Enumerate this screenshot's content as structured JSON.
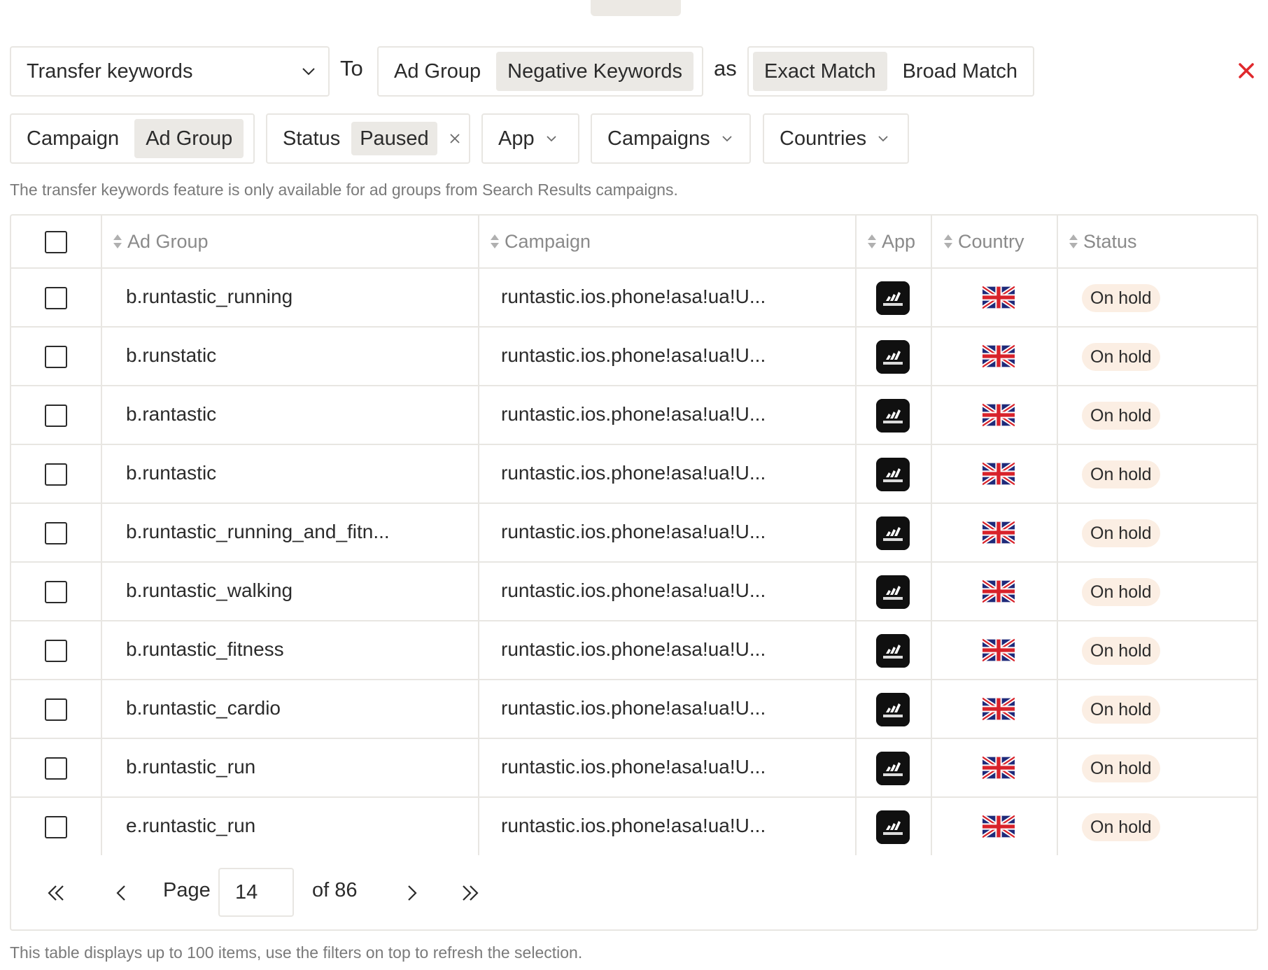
{
  "transfer": {
    "action_value": "Transfer keywords",
    "to_label": "To",
    "target_options": [
      "Ad Group",
      "Negative Keywords"
    ],
    "target_selected": "Negative Keywords",
    "as_label": "as",
    "match_options": [
      "Exact Match",
      "Broad Match"
    ],
    "match_selected": "Exact Match",
    "close_color": "#e0282c"
  },
  "filters": {
    "level_options": [
      "Campaign",
      "Ad Group"
    ],
    "level_selected": "Ad Group",
    "status_label": "Status",
    "status_value": "Paused",
    "app_label": "App",
    "campaigns_label": "Campaigns",
    "countries_label": "Countries"
  },
  "notes": {
    "availability": "The transfer keywords feature is only available for ad groups from Search Results campaigns.",
    "limit": "This table displays up to 100 items, use the filters on top to refresh the selection."
  },
  "table": {
    "headers": {
      "ad_group": "Ad Group",
      "campaign": "Campaign",
      "app": "App",
      "country": "Country",
      "status": "Status"
    },
    "rows": [
      {
        "ad_group": "b.runtastic_running",
        "campaign": "runtastic.ios.phone!asa!ua!U...",
        "app_icon": "adidas-running-app-icon",
        "country_flag": "uk-flag-icon",
        "status": "On hold"
      },
      {
        "ad_group": "b.runstatic",
        "campaign": "runtastic.ios.phone!asa!ua!U...",
        "app_icon": "adidas-running-app-icon",
        "country_flag": "uk-flag-icon",
        "status": "On hold"
      },
      {
        "ad_group": "b.rantastic",
        "campaign": "runtastic.ios.phone!asa!ua!U...",
        "app_icon": "adidas-running-app-icon",
        "country_flag": "uk-flag-icon",
        "status": "On hold"
      },
      {
        "ad_group": "b.runtastic",
        "campaign": "runtastic.ios.phone!asa!ua!U...",
        "app_icon": "adidas-running-app-icon",
        "country_flag": "uk-flag-icon",
        "status": "On hold"
      },
      {
        "ad_group": "b.runtastic_running_and_fitn...",
        "campaign": "runtastic.ios.phone!asa!ua!U...",
        "app_icon": "adidas-running-app-icon",
        "country_flag": "uk-flag-icon",
        "status": "On hold"
      },
      {
        "ad_group": "b.runtastic_walking",
        "campaign": "runtastic.ios.phone!asa!ua!U...",
        "app_icon": "adidas-running-app-icon",
        "country_flag": "uk-flag-icon",
        "status": "On hold"
      },
      {
        "ad_group": "b.runtastic_fitness",
        "campaign": "runtastic.ios.phone!asa!ua!U...",
        "app_icon": "adidas-running-app-icon",
        "country_flag": "uk-flag-icon",
        "status": "On hold"
      },
      {
        "ad_group": "b.runtastic_cardio",
        "campaign": "runtastic.ios.phone!asa!ua!U...",
        "app_icon": "adidas-running-app-icon",
        "country_flag": "uk-flag-icon",
        "status": "On hold"
      },
      {
        "ad_group": "b.runtastic_run",
        "campaign": "runtastic.ios.phone!asa!ua!U...",
        "app_icon": "adidas-running-app-icon",
        "country_flag": "uk-flag-icon",
        "status": "On hold"
      },
      {
        "ad_group": "e.runtastic_run",
        "campaign": "runtastic.ios.phone!asa!ua!U...",
        "app_icon": "adidas-running-app-icon",
        "country_flag": "uk-flag-icon",
        "status": "On hold"
      }
    ]
  },
  "pagination": {
    "page_label": "Page",
    "current_page": "14",
    "of_label": "of 86"
  }
}
